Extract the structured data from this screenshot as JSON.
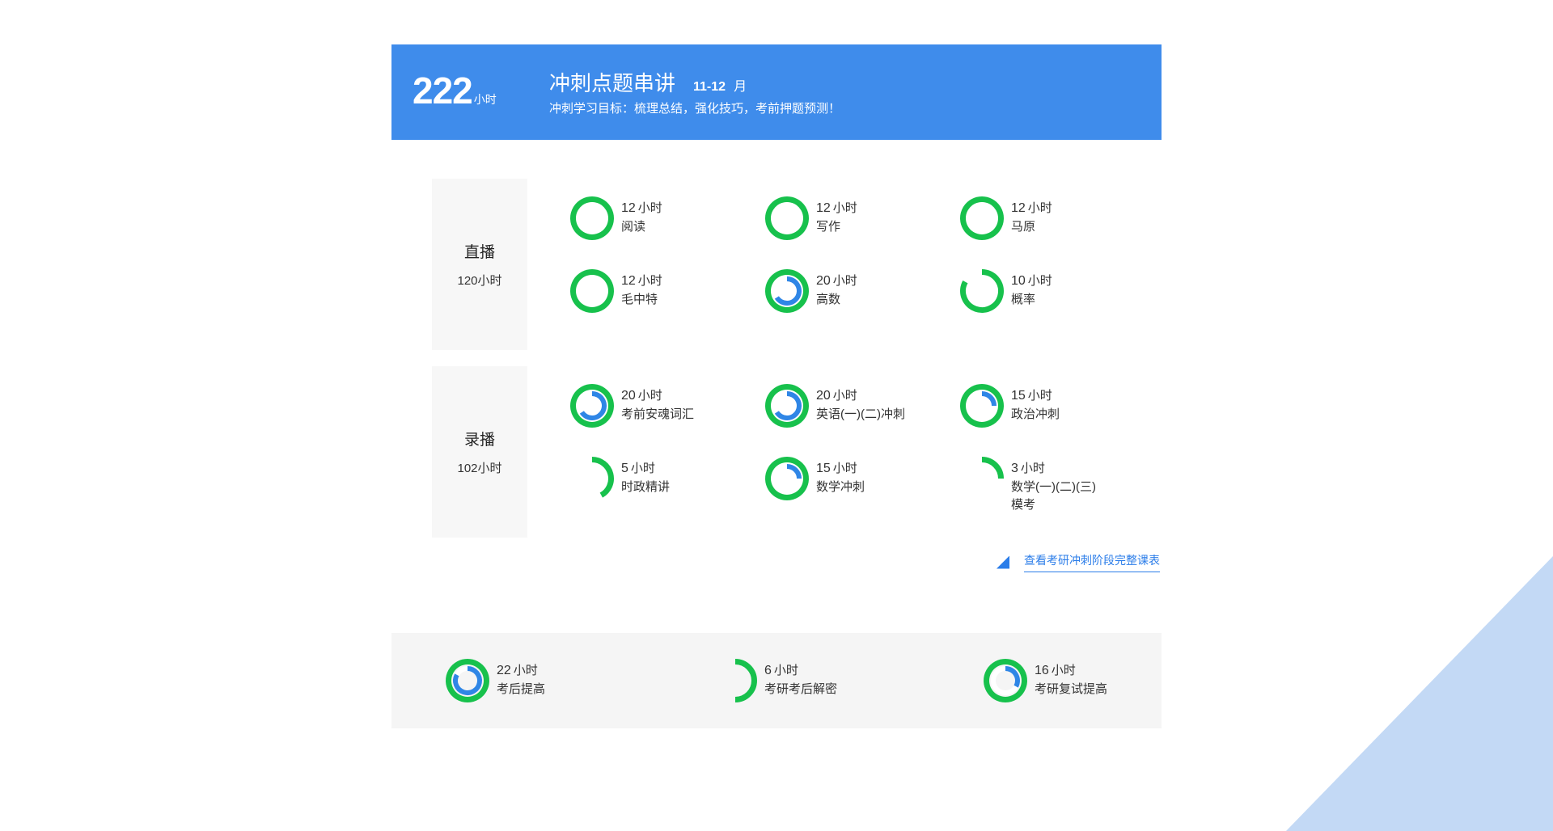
{
  "header": {
    "total_hours": "222",
    "total_unit": "小时",
    "title": "冲刺点题串讲",
    "months": "11-12",
    "month_unit": "月",
    "subtitle": "冲刺学习目标：梳理总结，强化技巧，考前押题预测！"
  },
  "colors": {
    "banner": "#3f8ceb",
    "ring_green": "#17c14c",
    "ring_blue": "#2f86e6",
    "triangle": "#c3d9f5"
  },
  "live": {
    "label": "直播",
    "hours": "120小时",
    "items": [
      {
        "hours": "12",
        "unit": "小时",
        "name": "阅读",
        "progress": 1.0,
        "inner": 0
      },
      {
        "hours": "12",
        "unit": "小时",
        "name": "写作",
        "progress": 1.0,
        "inner": 0
      },
      {
        "hours": "12",
        "unit": "小时",
        "name": "马原",
        "progress": 1.0,
        "inner": 0
      },
      {
        "hours": "12",
        "unit": "小时",
        "name": "毛中特",
        "progress": 1.0,
        "inner": 0
      },
      {
        "hours": "20",
        "unit": "小时",
        "name": "高数",
        "progress": 1.0,
        "inner": 0.66
      },
      {
        "hours": "10",
        "unit": "小时",
        "name": "概率",
        "progress": 0.83,
        "inner": 0
      }
    ]
  },
  "recorded": {
    "label": "录播",
    "hours": "102小时",
    "items": [
      {
        "hours": "20",
        "unit": "小时",
        "name": "考前安魂词汇",
        "progress": 1.0,
        "inner": 0.66
      },
      {
        "hours": "20",
        "unit": "小时",
        "name": "英语(一)(二)冲刺",
        "progress": 1.0,
        "inner": 0.66
      },
      {
        "hours": "15",
        "unit": "小时",
        "name": "政治冲刺",
        "progress": 1.0,
        "inner": 0.25
      },
      {
        "hours": "5",
        "unit": "小时",
        "name": "时政精讲",
        "progress": 0.42,
        "inner": 0
      },
      {
        "hours": "15",
        "unit": "小时",
        "name": "数学冲刺",
        "progress": 1.0,
        "inner": 0.25
      },
      {
        "hours": "3",
        "unit": "小时",
        "name": "数学(一)(二)(三)模考",
        "progress": 0.25,
        "inner": 0
      }
    ]
  },
  "link": {
    "label": "查看考研冲刺阶段完整课表"
  },
  "extras": {
    "items": [
      {
        "hours": "22",
        "unit": "小时",
        "name": "考后提高",
        "progress": 1.0,
        "inner": 0.83
      },
      {
        "hours": "6",
        "unit": "小时",
        "name": "考研考后解密",
        "progress": 0.5,
        "inner": 0
      },
      {
        "hours": "16",
        "unit": "小时",
        "name": "考研复试提高",
        "progress": 1.0,
        "inner": 0.33
      }
    ]
  }
}
